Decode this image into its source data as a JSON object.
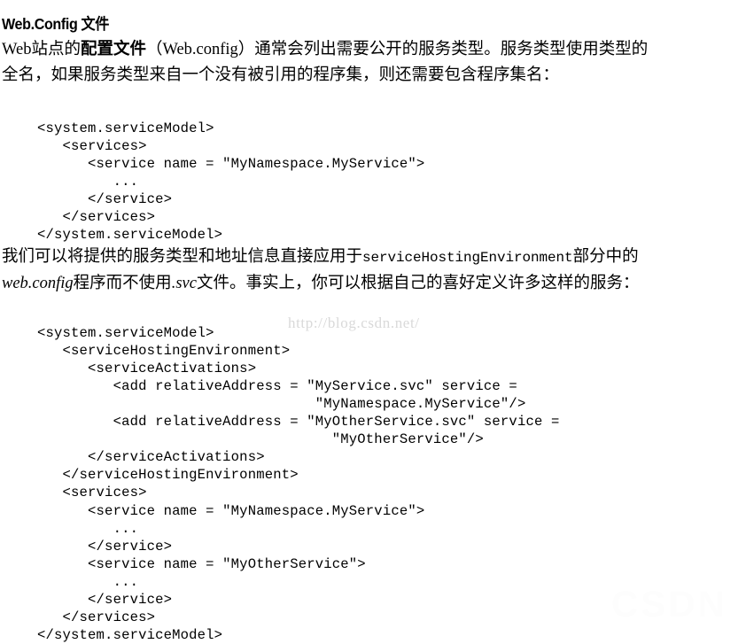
{
  "document": {
    "heading": "Web.Config 文件",
    "paragraph_1": {
      "line_1_part_1": "Web站点的",
      "line_1_bold": "配置文件",
      "line_1_part_2": "（Web.config）通常会列出需要公开的服务类型。服务类型使用类型的",
      "line_2": "全名，如果服务类型来自一个没有被引用的程序集，则还需要包含程序集名："
    },
    "paragraph_2": {
      "line_1_part_1": "我们可以将提供的服务类型和地址信息直接应用于",
      "line_1_mono": "serviceHostingEnvironment",
      "line_1_part_2": "部分中的",
      "line_2_italic_1": "web.config",
      "line_2_part_1": "程序而不使用",
      "line_2_italic_2": ".svc",
      "line_2_part_2": "文件。事实上，你可以根据自己的喜好定义许多这样的服务："
    },
    "code_block_1": "<system.serviceModel>\n   <services>\n      <service name = \"MyNamespace.MyService\">\n         ...\n      </service>\n   </services>\n</system.serviceModel>",
    "code_block_2": "<system.serviceModel>\n   <serviceHostingEnvironment>\n      <serviceActivations>\n         <add relativeAddress = \"MyService.svc\" service =\n                                 \"MyNamespace.MyService\"/>\n         <add relativeAddress = \"MyOtherService.svc\" service =\n                                   \"MyOtherService\"/>\n      </serviceActivations>\n   </serviceHostingEnvironment>\n   <services>\n      <service name = \"MyNamespace.MyService\">\n         ...\n      </service>\n      <service name = \"MyOtherService\">\n         ...\n      </service>\n   </services>\n</system.serviceModel>",
    "watermark_url": "http://blog.csdn.net/",
    "watermark_faint": "CSDN"
  },
  "colors": {
    "page_background": "#ffffff",
    "text": "#000000",
    "watermark_url": "#d9d9d9",
    "watermark_faint": "#fdfdfd"
  }
}
